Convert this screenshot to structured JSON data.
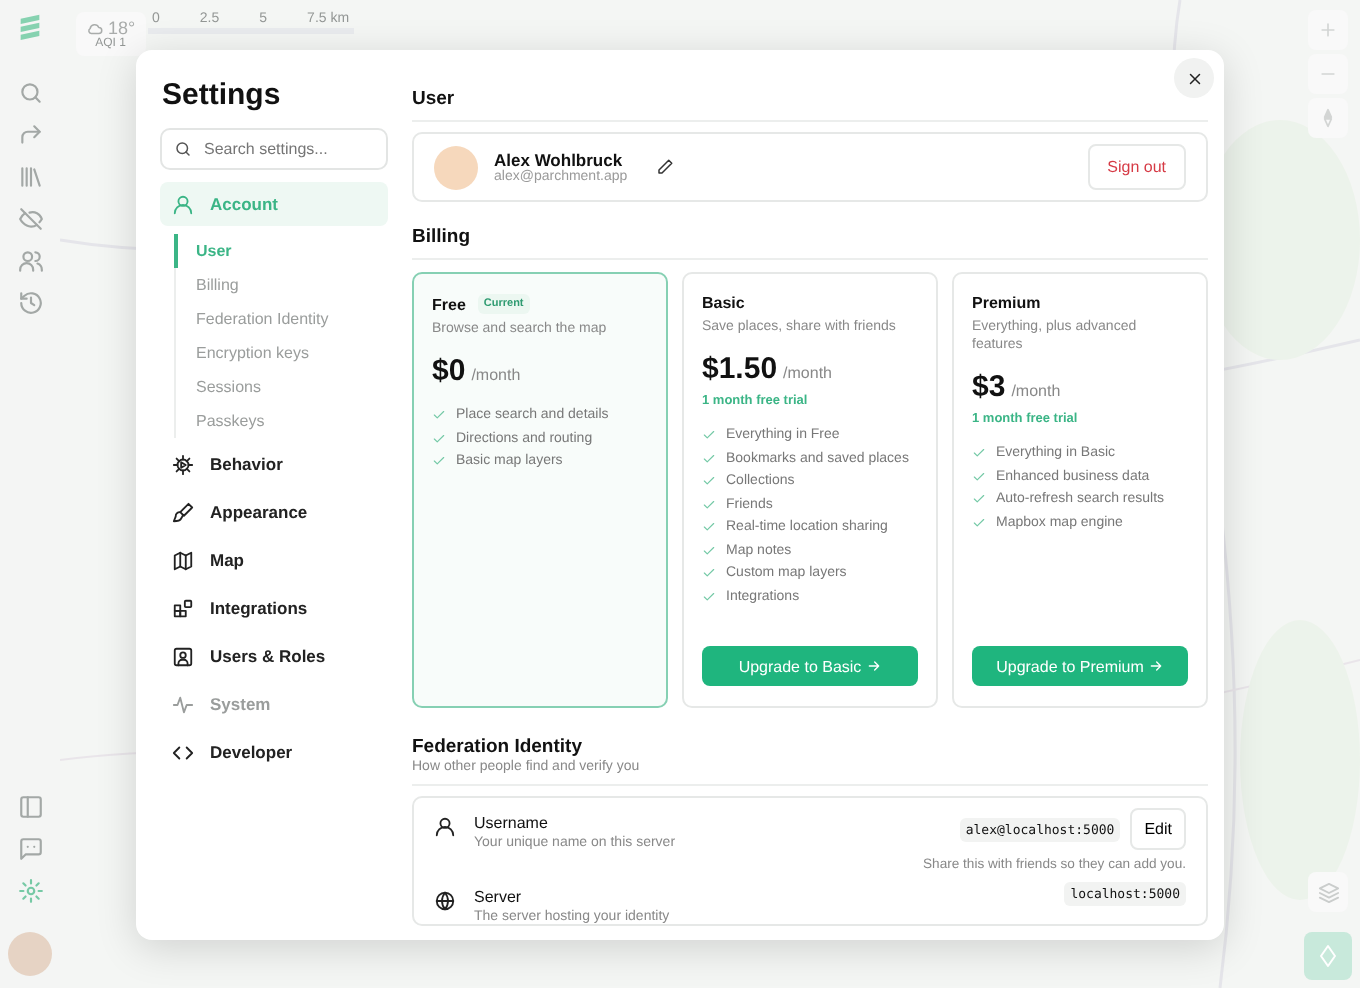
{
  "rail": {
    "items": [
      {
        "selected": false
      },
      {
        "selected": false
      },
      {
        "selected": false
      },
      {
        "selected": false
      },
      {
        "selected": false
      },
      {
        "selected": false
      },
      {
        "selected": false
      },
      {
        "selected": false
      },
      {
        "selected": true
      }
    ]
  },
  "weather": {
    "temperature": "18°",
    "aqi": "AQI 1"
  },
  "scale": {
    "labels": [
      "0",
      "2.5",
      "5",
      "7.5 km"
    ]
  },
  "settings": {
    "title": "Settings",
    "search": {
      "placeholder": "Search settings..."
    },
    "nav": [
      {
        "label": "Account",
        "selected": true,
        "expanded": true,
        "disabled": false,
        "children": [
          {
            "label": "User",
            "selected": true
          },
          {
            "label": "Billing",
            "selected": false
          },
          {
            "label": "Federation Identity",
            "selected": false
          },
          {
            "label": "Encryption keys",
            "selected": false
          },
          {
            "label": "Sessions",
            "selected": false
          },
          {
            "label": "Passkeys",
            "selected": false
          }
        ]
      },
      {
        "label": "Behavior",
        "selected": false,
        "disabled": false
      },
      {
        "label": "Appearance",
        "selected": false,
        "disabled": false
      },
      {
        "label": "Map",
        "selected": false,
        "disabled": false
      },
      {
        "label": "Integrations",
        "selected": false,
        "disabled": false
      },
      {
        "label": "Users & Roles",
        "selected": false,
        "disabled": false
      },
      {
        "label": "System",
        "selected": false,
        "disabled": true
      },
      {
        "label": "Developer",
        "selected": false,
        "disabled": false
      }
    ],
    "user": {
      "heading": "User",
      "name": "Alex Wohlbruck",
      "email": "alex@parchment.app",
      "sign_out": "Sign out"
    },
    "billing": {
      "heading": "Billing",
      "plans": [
        {
          "name": "Free",
          "badge": "Current",
          "current": true,
          "description": "Browse and search the map",
          "price": "$0",
          "period": "/month",
          "features": [
            "Place search and details",
            "Directions and routing",
            "Basic map layers"
          ]
        },
        {
          "name": "Basic",
          "current": false,
          "description": "Save places, share with friends",
          "price": "$1.50",
          "period": "/month",
          "trial": "1 month free trial",
          "features": [
            "Everything in Free",
            "Bookmarks and saved places",
            "Collections",
            "Friends",
            "Real-time location sharing",
            "Map notes",
            "Custom map layers",
            "Integrations"
          ],
          "button": "Upgrade to Basic"
        },
        {
          "name": "Premium",
          "current": false,
          "description": "Everything, plus advanced features",
          "price": "$3",
          "period": "/month",
          "trial": "1 month free trial",
          "features": [
            "Everything in Basic",
            "Enhanced business data",
            "Auto-refresh search results",
            "Mapbox map engine"
          ],
          "button": "Upgrade to Premium"
        }
      ]
    },
    "federation": {
      "heading": "Federation Identity",
      "subtitle": "How other people find and verify you",
      "rows": [
        {
          "kind": "user",
          "label": "Username",
          "description": "Your unique name on this server",
          "value": "alex@localhost:5000",
          "button": "Edit",
          "note": "Share this with friends so they can add you."
        },
        {
          "kind": "server",
          "label": "Server",
          "description": "The server hosting your identity",
          "value": "localhost:5000"
        }
      ]
    }
  }
}
